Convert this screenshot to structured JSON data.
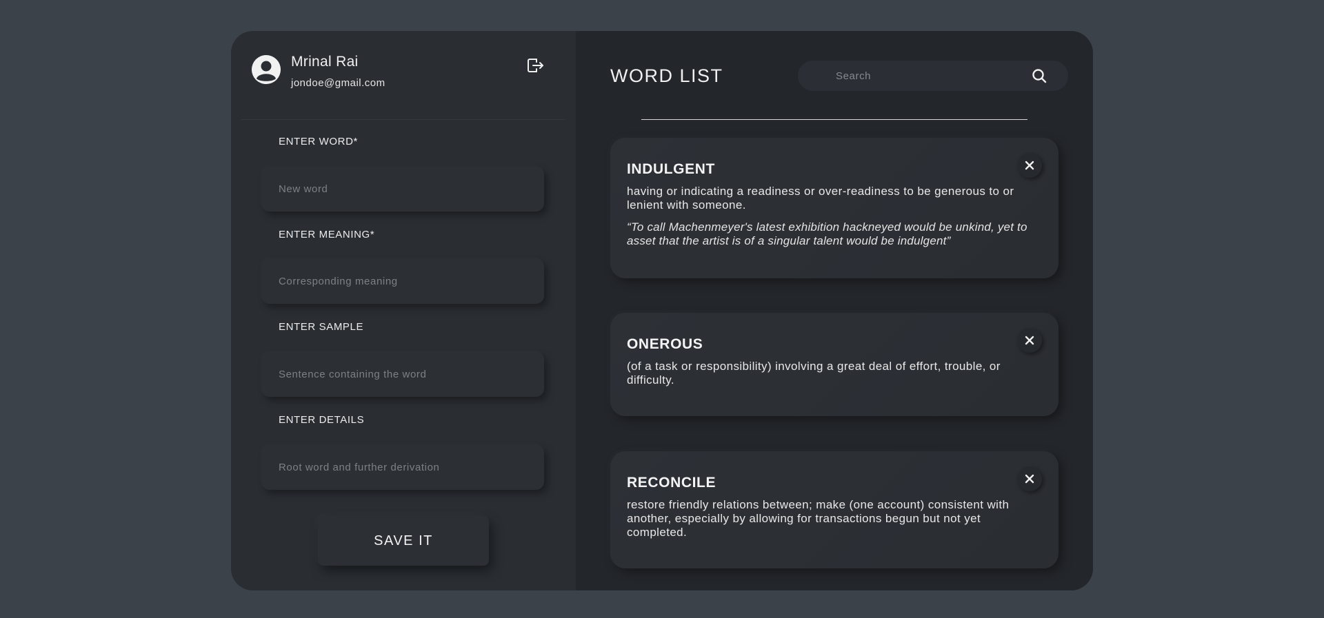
{
  "user": {
    "name": "Mrinal Rai",
    "email": "jondoe@gmail.com"
  },
  "form": {
    "word_label": "ENTER WORD*",
    "word_placeholder": "New word",
    "meaning_label": "ENTER MEANING*",
    "meaning_placeholder": "Corresponding meaning",
    "sample_label": "ENTER SAMPLE",
    "sample_placeholder": "Sentence containing the word",
    "details_label": "ENTER DETAILS",
    "details_placeholder": "Root word and further derivation",
    "save_label": "SAVE IT"
  },
  "list": {
    "title": "WORD LIST",
    "search_placeholder": "Search",
    "cards": [
      {
        "word": "INDULGENT",
        "meaning": "having or indicating a readiness or over-readiness to be generous to or lenient with someone.",
        "sample": "“To call Machenmeyer's latest exhibition hackneyed would be unkind, yet to asset that the artist is of a singular talent would be indulgent”"
      },
      {
        "word": "ONEROUS",
        "meaning": "(of a task or responsibility) involving a great deal of effort, trouble, or difficulty.",
        "sample": ""
      },
      {
        "word": "RECONCILE",
        "meaning": "restore friendly relations between; make (one account) consistent with another, especially by allowing for transactions begun but not yet completed.",
        "sample": ""
      }
    ]
  },
  "icons": {
    "avatar": "user-avatar-icon",
    "logout": "logout-icon",
    "search": "search-icon",
    "close": "close-icon"
  },
  "colors": {
    "background": "#3b424a",
    "left_panel": "#2a2e33",
    "right_panel": "#23262b",
    "text": "#f0f0f0"
  }
}
